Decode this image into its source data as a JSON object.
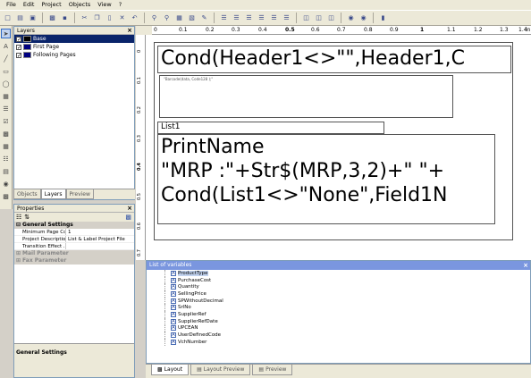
{
  "menubar": {
    "items": [
      "File",
      "Edit",
      "Project",
      "Objects",
      "View",
      "?"
    ]
  },
  "layers": {
    "title": "Layers",
    "items": [
      {
        "label": "Base",
        "checked": true,
        "selected": true
      },
      {
        "label": "First Page",
        "checked": true,
        "selected": false
      },
      {
        "label": "Following Pages",
        "checked": true,
        "selected": false
      }
    ],
    "tabs": [
      "Objects",
      "Layers",
      "Preview"
    ],
    "active_tab": "Layers"
  },
  "properties": {
    "title": "Properties",
    "general_group": "General Settings",
    "rows": [
      {
        "key": "Minimum Page Co...",
        "value": "1"
      },
      {
        "key": "Project Description",
        "value": "List & Label Project File"
      },
      {
        "key": "Transition Effect ...",
        "value": ""
      }
    ],
    "mail_group": "Mail Parameter",
    "fax_group": "Fax Parameter",
    "description_title": "General Settings"
  },
  "ruler": {
    "h_ticks": [
      "0",
      "0.1",
      "0.2",
      "0.3",
      "0.4",
      "0.5",
      "0.6",
      "0.7",
      "0.8",
      "0.9",
      "1",
      "1.1",
      "1.2",
      "1.3",
      "1.4"
    ],
    "unit": "in",
    "v_ticks": [
      "0",
      "0.1",
      "0.2",
      "0.3",
      "0.4",
      "0.5",
      "0.6",
      "0.7"
    ]
  },
  "canvas": {
    "header_text": "Cond(Header1<>\"\",Header1,C",
    "tiny_text": "\"Barcode(data, Code128 );\"",
    "list_label": "List1",
    "line1": "PrintName",
    "line2": "\"MRP :\"+Str$(MRP,3,2)+\"     \"+",
    "line3": "Cond(List1<>\"None\",Field1N"
  },
  "variables": {
    "title": "List of variables",
    "items": [
      "ProductType",
      "PurchaseCost",
      "Quantity",
      "SellingPrice",
      "SPWithoutDecimal",
      "SrlNo",
      "SupplierRef",
      "SupplierRefDate",
      "UPCEAN",
      "UserDefinedCode",
      "VchNumber"
    ]
  },
  "view_tabs": {
    "items": [
      "Layout",
      "Layout Preview",
      "Preview"
    ],
    "active": "Layout"
  }
}
